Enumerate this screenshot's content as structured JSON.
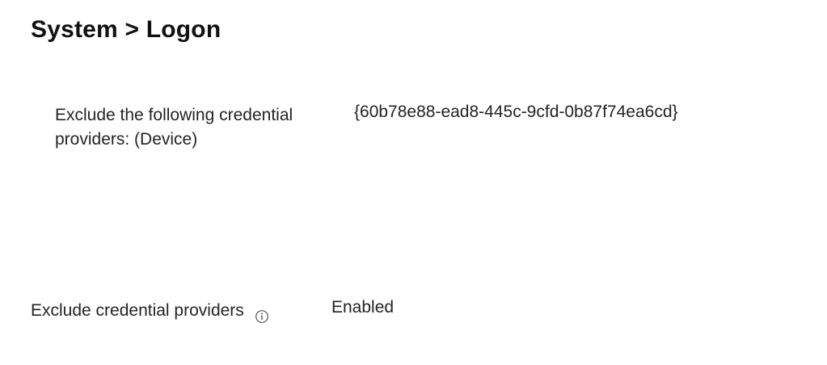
{
  "header": {
    "title": "System > Logon"
  },
  "credential_setting": {
    "label": "Exclude the following credential providers: (Device)",
    "value": "{60b78e88-ead8-445c-9cfd-0b87f74ea6cd}"
  },
  "policy_setting": {
    "label": "Exclude credential providers",
    "info_icon": "info-icon",
    "value": "Enabled"
  }
}
